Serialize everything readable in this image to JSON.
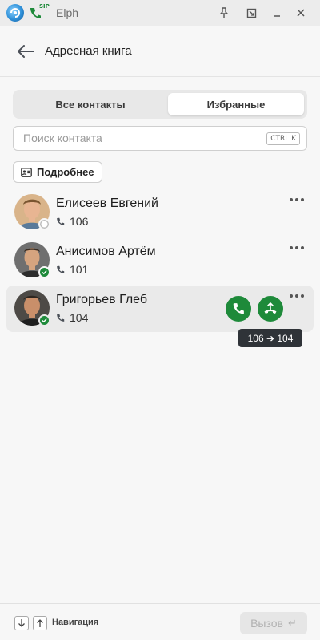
{
  "window": {
    "title": "Elph",
    "sip_badge": "SIP"
  },
  "header": {
    "title": "Адресная книга"
  },
  "tabs": [
    {
      "label": "Все контакты",
      "selected": false
    },
    {
      "label": "Избранные",
      "selected": true
    }
  ],
  "search": {
    "placeholder": "Поиск контакта",
    "value": "",
    "shortcut": "CTRL K"
  },
  "details_button": {
    "label": "Подробнее"
  },
  "contacts": [
    {
      "name": "Елисеев Евгений",
      "extension": "106",
      "status": "offline",
      "active": false
    },
    {
      "name": "Анисимов Артём",
      "extension": "101",
      "status": "online",
      "active": false
    },
    {
      "name": "Григорьев Глеб",
      "extension": "104",
      "status": "online",
      "active": true
    }
  ],
  "tooltip": {
    "text": "106 ➔ 104"
  },
  "footer": {
    "navigation_label": "Навигация",
    "call_label": "Вызов",
    "call_enabled": false
  },
  "colors": {
    "accent_green": "#1e8a3a",
    "tooltip_bg": "#2f3338",
    "background": "#f7f7f7"
  },
  "icons": {
    "app": "app-logo-icon",
    "sip": "sip-phone-icon",
    "pin": "pin-icon",
    "restore": "restore-icon",
    "minimize": "minimize-icon",
    "close": "close-icon",
    "back": "arrow-left-icon",
    "contact_card": "contact-card-icon",
    "phone": "phone-icon",
    "transfer": "call-transfer-icon",
    "more": "more-horizontal-icon",
    "arrow_down": "arrow-down-icon",
    "arrow_up": "arrow-up-icon",
    "enter": "enter-key-icon"
  }
}
